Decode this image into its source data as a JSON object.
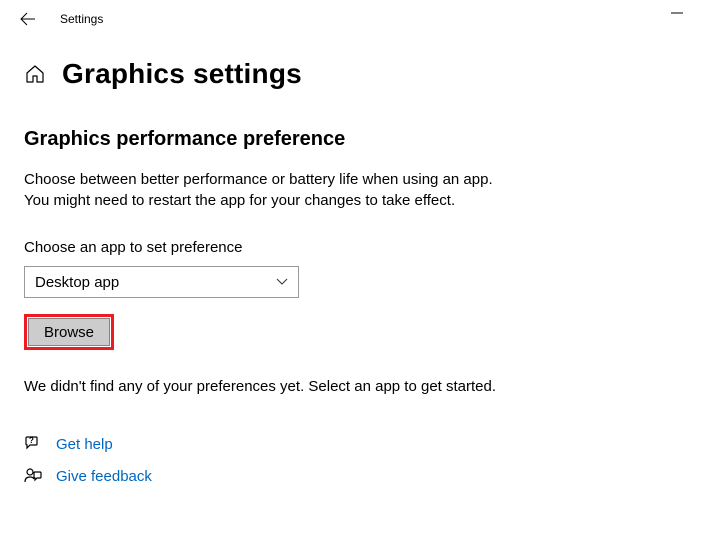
{
  "window": {
    "title": "Settings"
  },
  "page": {
    "title": "Graphics settings"
  },
  "section": {
    "title": "Graphics performance preference",
    "description_line1": "Choose between better performance or battery life when using an app.",
    "description_line2": "You might need to restart the app for your changes to take effect."
  },
  "appSelector": {
    "label": "Choose an app to set preference",
    "selected": "Desktop app",
    "browse_label": "Browse"
  },
  "status": {
    "empty_message": "We didn't find any of your preferences yet. Select an app to get started."
  },
  "footer": {
    "help_label": "Get help",
    "feedback_label": "Give feedback"
  }
}
